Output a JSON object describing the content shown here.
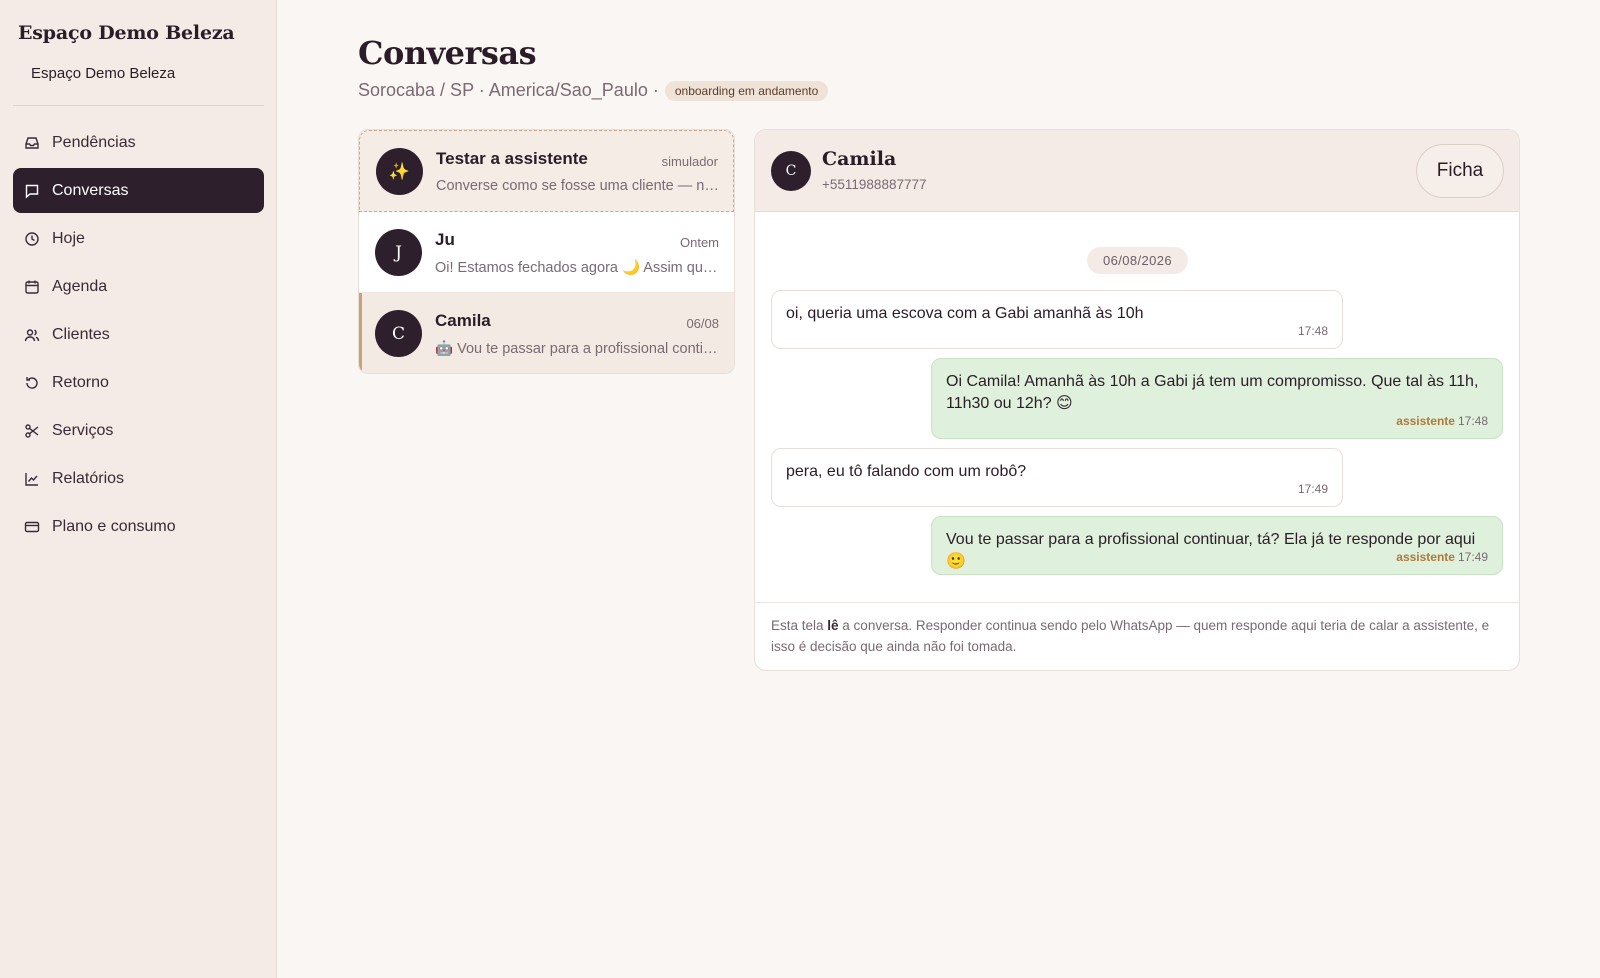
{
  "sidebar": {
    "brand": "Espaço Demo Beleza",
    "brand_sub": "Espaço Demo Beleza",
    "items": [
      {
        "label": "Pendências",
        "icon": "inbox-icon"
      },
      {
        "label": "Conversas",
        "icon": "message-icon",
        "active": true
      },
      {
        "label": "Hoje",
        "icon": "clock-icon"
      },
      {
        "label": "Agenda",
        "icon": "calendar-icon"
      },
      {
        "label": "Clientes",
        "icon": "users-icon"
      },
      {
        "label": "Retorno",
        "icon": "rotate-icon"
      },
      {
        "label": "Serviços",
        "icon": "scissors-icon"
      },
      {
        "label": "Relatórios",
        "icon": "chart-icon"
      },
      {
        "label": "Plano e consumo",
        "icon": "credit-card-icon"
      }
    ]
  },
  "header": {
    "title": "Conversas",
    "location": "Sorocaba / SP · America/Sao_Paulo ·",
    "badge": "onboarding em andamento"
  },
  "conversations": [
    {
      "avatar": "✨",
      "name": "Testar a assistente",
      "meta": "simulador",
      "preview": "Converse como se fosse uma cliente — nada é enviado de verdade"
    },
    {
      "avatar": "J",
      "name": "Ju",
      "meta": "Ontem",
      "preview": "Oi! Estamos fechados agora 🌙 Assim que abrirmos te respondemos"
    },
    {
      "avatar": "C",
      "name": "Camila",
      "meta": "06/08",
      "preview": "🤖 Vou te passar para a profissional continuar, tá?"
    }
  ],
  "chat": {
    "avatar": "C",
    "name": "Camila",
    "phone": "+5511988887777",
    "ficha_label": "Ficha",
    "date": "06/08/2026",
    "messages": [
      {
        "dir": "in",
        "text": "oi, queria uma escova com a Gabi amanhã às 10h",
        "time": "17:48"
      },
      {
        "dir": "out",
        "text": "Oi Camila! Amanhã às 10h a Gabi já tem um compromisso. Que tal às 11h, 11h30 ou 12h? 😊",
        "who": "assistente",
        "time": "17:48"
      },
      {
        "dir": "in",
        "text": "pera, eu tô falando com um robô?",
        "time": "17:49"
      },
      {
        "dir": "out",
        "text": "Vou te passar para a profissional continuar, tá? Ela já te responde por aqui 🙂",
        "who": "assistente",
        "time": "17:49"
      }
    ],
    "footer": {
      "pre": "Esta tela ",
      "bold": "lê",
      "post": " a conversa. Responder continua sendo pelo WhatsApp — quem responde aqui teria de calar a assistente, e isso é decisão que ainda não foi tomada."
    }
  },
  "colors": {
    "accent_dark": "#2d1f2b",
    "outgoing_bubble": "#dff0dc",
    "assistant_label": "#b07a38",
    "selected_bar": "#c9a27a"
  }
}
